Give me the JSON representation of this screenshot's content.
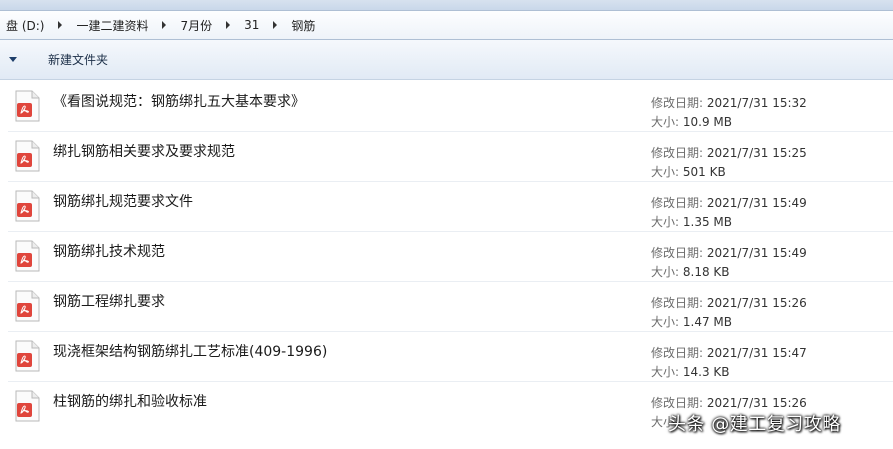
{
  "address": {
    "drive_label": "盘 (D:)",
    "crumbs": [
      "一建二建资料",
      "7月份",
      "31",
      "钢筋"
    ]
  },
  "toolbar": {
    "new_folder_label": "新建文件夹"
  },
  "labels": {
    "modified": "修改日期:",
    "size": "大小:"
  },
  "files": [
    {
      "name": "《看图说规范：钢筋绑扎五大基本要求》",
      "modified": "2021/7/31 15:32",
      "size": "10.9 MB"
    },
    {
      "name": "绑扎钢筋相关要求及要求规范",
      "modified": "2021/7/31 15:25",
      "size": "501 KB"
    },
    {
      "name": "钢筋绑扎规范要求文件",
      "modified": "2021/7/31 15:49",
      "size": "1.35 MB"
    },
    {
      "name": "钢筋绑扎技术规范",
      "modified": "2021/7/31 15:49",
      "size": "8.18 KB"
    },
    {
      "name": "钢筋工程绑扎要求",
      "modified": "2021/7/31 15:26",
      "size": "1.47 MB"
    },
    {
      "name": "现浇框架结构钢筋绑扎工艺标准(409-1996)",
      "modified": "2021/7/31 15:47",
      "size": "14.3 KB"
    },
    {
      "name": "柱钢筋的绑扎和验收标准",
      "modified": "2021/7/31 15:26",
      "size": ""
    }
  ],
  "watermark": "头条 @建工复习攻略",
  "colors": {
    "pdf_icon": "#e0463c",
    "toolbar_text": "#1c2f48"
  }
}
